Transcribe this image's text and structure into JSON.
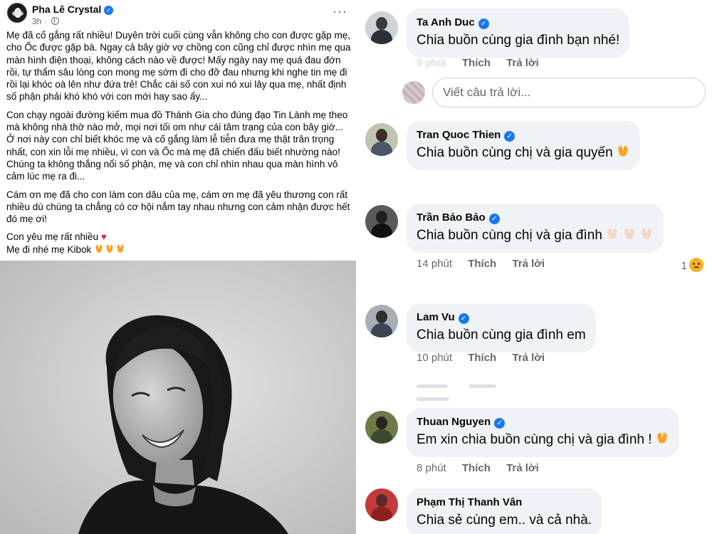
{
  "post": {
    "author": "Pha Lê Crystal",
    "time": "3h",
    "more_label": "···",
    "paragraphs": [
      "Mẹ đã cố gắng rất nhiều! Duyên trời cuối cùng vẫn không cho con được gặp mẹ, cho Ốc được gặp bà. Ngay cả bây giờ vợ chồng con cũng chỉ được nhìn mẹ qua màn hình điện thoại, không cách nào về được! Mấy ngày nay mẹ quá đau đớn rồi, tự thẩm sâu lòng con mong mẹ sớm đi cho đỡ đau nhưng khi nghe tin mẹ đi rồi lại khóc oà lên như đứa trẻ! Chắc cái số con xui nó xui lây qua mẹ, nhất định số phận phải khó khó với con mới hay sao ấy...",
      "Con chạy ngoài đường kiếm mua đồ Thánh Gia cho đúng đạo Tin Lành mẹ theo mà không nhà thờ nào mở, mọi nơi tối om như cái tâm trạng của con bây giờ... Ở nơi này con chỉ biết khóc mẹ và cố gắng làm lễ tiễn đưa mẹ thật trân trọng nhất, con xin lỗi mẹ nhiều, vì con và Ốc mà mẹ đã chiến đấu biết nhường nào! Chúng ta không thắng nổi số phận, mẹ và con chỉ nhìn nhau qua màn hình vô cảm lúc mẹ ra đi...",
      "Cám ơn mẹ đã cho con làm con dâu của mẹ, cám ơn mẹ đã yêu thương con rất nhiều dù chúng ta chẳng có cơ hội nắm tay nhau nhưng con cảm nhận được hết đó mẹ ơi!"
    ],
    "closing_line1": "Con yêu mẹ rất nhiều",
    "closing_line2": "Mẹ đi nhé mẹ Kibok"
  },
  "comments": {
    "reply_placeholder": "Viết câu trả lời...",
    "items": [
      {
        "name": "Ta Anh Duc",
        "verified": true,
        "text": "Chia buồn cùng gia đình bạn nhé!",
        "time": "",
        "like": "Thích",
        "reply": "Trả lời"
      },
      {
        "name": "Tran Quoc Thien",
        "verified": true,
        "text": "Chia buồn cùng chị và gia quyến",
        "time": "",
        "like": "",
        "reply": ""
      },
      {
        "name": "Trần Bảo Bảo",
        "verified": true,
        "text": "Chia buồn cùng chị và gia đình",
        "time": "14 phút",
        "like": "Thích",
        "reply": "Trả lời",
        "reaction_count": "1"
      },
      {
        "name": "Lam Vu",
        "verified": true,
        "text": "Chia buồn cùng gia đình em",
        "time": "10 phút",
        "like": "Thích",
        "reply": "Trả lời"
      },
      {
        "name": "Thuan Nguyen",
        "verified": true,
        "text": "Em xin chia buồn cùng chị và gia đình !",
        "time": "8 phút",
        "like": "Thích",
        "reply": "Trả lời"
      },
      {
        "name": "Phạm Thị Thanh Vân",
        "verified": false,
        "text": "Chia sẻ cùng em.. và cả nhà.",
        "time": "",
        "like": "",
        "reply": ""
      }
    ]
  },
  "colors": {
    "bubble": "#f0f2f5",
    "meta_text": "#65676b",
    "verified": "#1877f2",
    "heart": "#e0245e"
  }
}
